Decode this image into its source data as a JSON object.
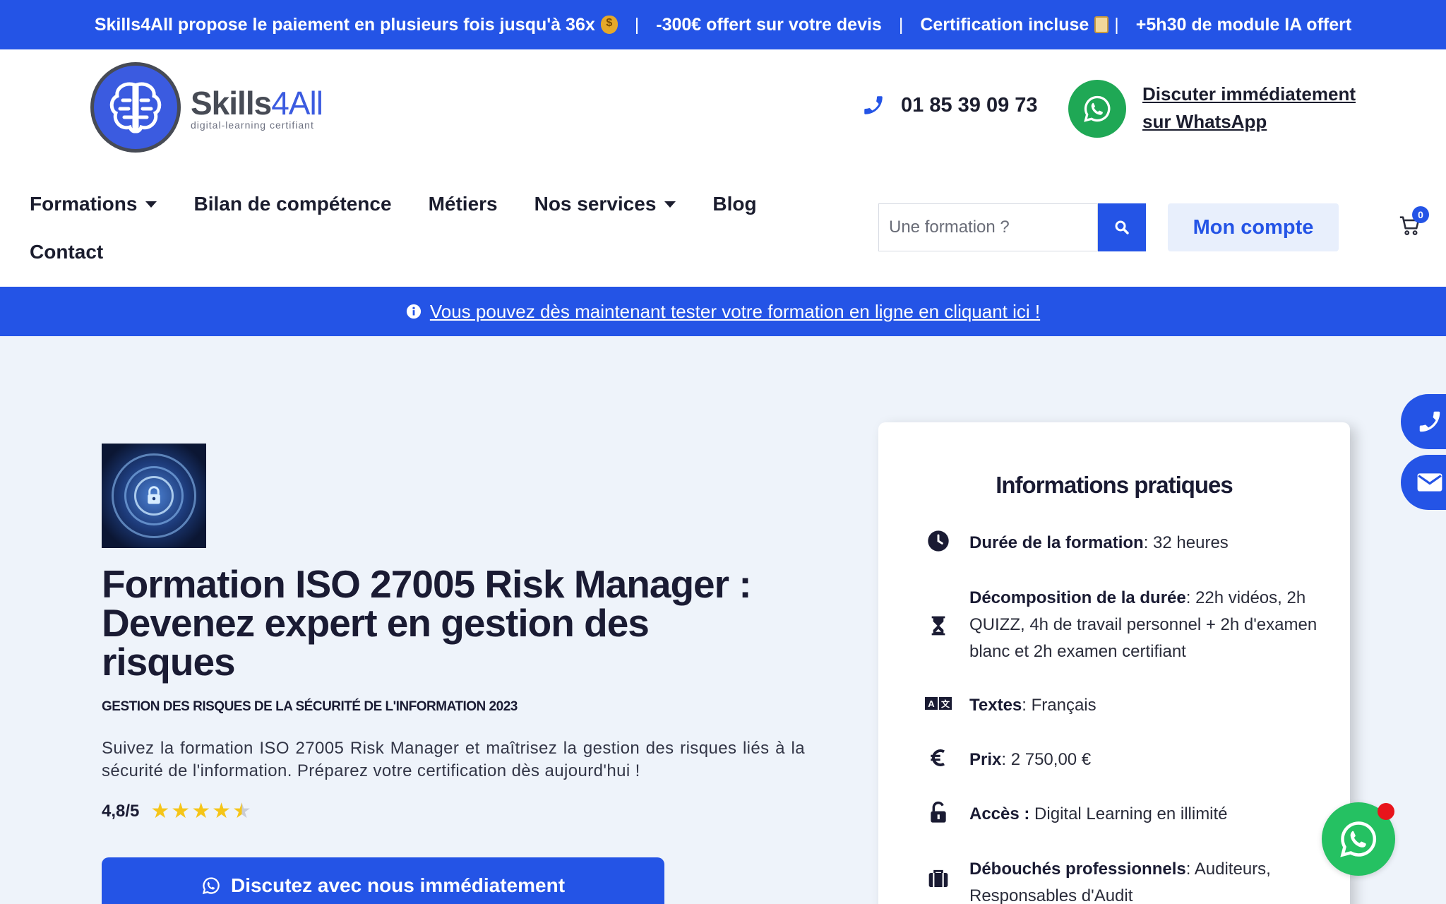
{
  "promo": {
    "item1": "Skills4All propose le paiement en plusieurs fois jusqu'à 36x",
    "item2": "-300€ offert sur votre devis",
    "item3": "Certification incluse",
    "item4": "+5h30 de module IA offert",
    "separator": "|"
  },
  "brand": {
    "name_part1": "Skills",
    "name_part2": "4All",
    "tagline": "digital-learning certifiant"
  },
  "contact": {
    "phone": "01 85 39 09 73",
    "whatsapp_line1": "Discuter immédiatement",
    "whatsapp_line2": "sur WhatsApp"
  },
  "nav": {
    "formations": "Formations",
    "bilan": "Bilan de compétence",
    "metiers": "Métiers",
    "services": "Nos services",
    "blog": "Blog",
    "contact": "Contact"
  },
  "search": {
    "placeholder": "Une formation ?"
  },
  "account": {
    "label": "Mon compte"
  },
  "cart": {
    "count": "0"
  },
  "banner": {
    "text": "Vous pouvez dès maintenant tester votre formation en ligne en cliquant ici !"
  },
  "hero": {
    "title": "Formation ISO 27005 Risk Manager : Devenez expert en gestion des risques",
    "subtitle": "GESTION DES RISQUES DE LA SÉCURITÉ DE L'INFORMATION 2023",
    "intro": "Suivez la formation ISO 27005 Risk Manager et maîtrisez la gestion des risques liés à la sécurité de l'information. Préparez votre certification dès aujourd'hui !",
    "rating": "4,8/5",
    "rating_stars": 4.5,
    "cta": "Discutez avec nous immédiatement"
  },
  "info_card": {
    "title": "Informations pratiques",
    "rows": [
      {
        "icon": "clock-icon",
        "label": "Durée de la formation",
        "value": ": 32 heures"
      },
      {
        "icon": "hourglass-icon",
        "label": "Décomposition de la durée",
        "value": ": 22h vidéos, 2h QUIZZ, 4h de travail personnel + 2h d'examen blanc et 2h examen certifiant"
      },
      {
        "icon": "language-icon",
        "label": "Textes",
        "value": ": Français"
      },
      {
        "icon": "euro-icon",
        "label": "Prix",
        "value": ": 2 750,00 €"
      },
      {
        "icon": "unlock-icon",
        "label": "Accès :",
        "value": " Digital Learning en illimité"
      },
      {
        "icon": "briefcase-icon",
        "label": "Débouchés professionnels",
        "value": ": Auditeurs, Responsables d'Audit"
      }
    ]
  },
  "colors": {
    "brand_blue": "#2454e6",
    "whatsapp_green": "#1fa855",
    "star": "#f5c518"
  }
}
